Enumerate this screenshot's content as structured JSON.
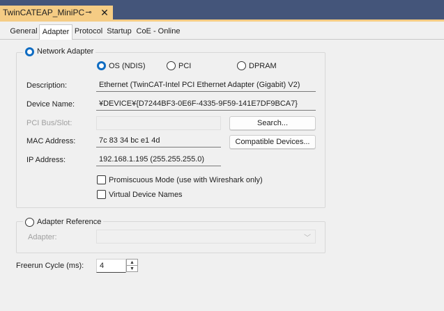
{
  "document_tab": {
    "title": "TwinCATEAP_MiniPC",
    "pin_glyph": "⊸",
    "close_glyph": "✕"
  },
  "tabs": [
    "General",
    "Adapter",
    "Protocol",
    "Startup",
    "CoE - Online"
  ],
  "network_adapter": {
    "label": "Network Adapter",
    "driver_options": [
      {
        "label": "OS (NDIS)",
        "checked": true
      },
      {
        "label": "PCI",
        "checked": false
      },
      {
        "label": "DPRAM",
        "checked": false
      }
    ],
    "description_label": "Description:",
    "description_value": "Ethernet (TwinCAT-Intel PCI Ethernet Adapter (Gigabit) V2)",
    "device_name_label": "Device Name:",
    "device_name_value": "¥DEVICE¥{D7244BF3-0E6F-4335-9F59-141E7DF9BCA7}",
    "pci_bus_label": "PCI Bus/Slot:",
    "pci_bus_value": "",
    "search_button": "Search...",
    "mac_label": "MAC Address:",
    "mac_value": "7c 83 34 bc e1 4d",
    "compatible_button": "Compatible Devices...",
    "ip_label": "IP Address:",
    "ip_value": "192.168.1.195 (255.255.255.0)",
    "promiscuous_label": "Promiscuous Mode (use with Wireshark only)",
    "virtual_names_label": "Virtual Device Names"
  },
  "adapter_reference": {
    "label": "Adapter Reference",
    "adapter_label": "Adapter:",
    "adapter_value": ""
  },
  "freerun": {
    "label": "Freerun Cycle (ms):",
    "value": "4"
  },
  "colors": {
    "accent": "#0f6cc2",
    "doc_tab": "#f5cc84",
    "frame": "#44557a"
  }
}
